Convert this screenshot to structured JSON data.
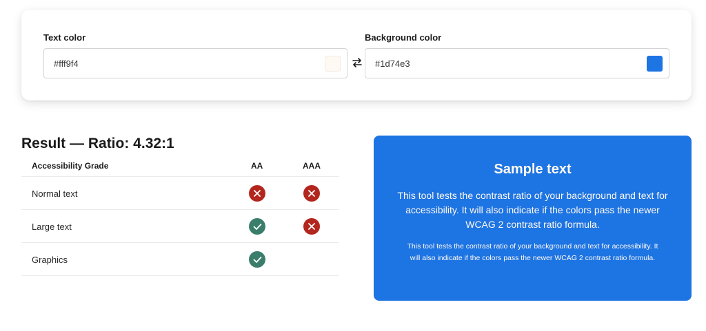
{
  "inputs": {
    "text_color": {
      "label": "Text color",
      "value": "#fff9f4",
      "swatch": "#fff9f4"
    },
    "background_color": {
      "label": "Background color",
      "value": "#1d74e3",
      "swatch": "#1d74e3"
    },
    "swap_icon": "swap-arrows-icon"
  },
  "result": {
    "title": "Result — Ratio: 4.32:1",
    "columns": {
      "grade": "Accessibility Grade",
      "aa": "AA",
      "aaa": "AAA"
    },
    "rows": [
      {
        "label": "Normal text",
        "aa": "fail",
        "aaa": "fail"
      },
      {
        "label": "Large text",
        "aa": "pass",
        "aaa": "fail"
      },
      {
        "label": "Graphics",
        "aa": "pass",
        "aaa": ""
      }
    ],
    "colors": {
      "pass": "#3a7d6b",
      "fail": "#b3261e"
    }
  },
  "sample": {
    "title": "Sample text",
    "large_body": "This tool tests the contrast ratio of your background and text for accessibility. It will also indicate if the colors pass the newer WCAG 2 contrast ratio formula.",
    "small_body": "This tool tests the contrast ratio of your background and text for accessibility. It will also indicate if the colors pass the newer WCAG 2 contrast ratio formula.",
    "background": "#1d74e3",
    "foreground": "#fff9f4"
  }
}
